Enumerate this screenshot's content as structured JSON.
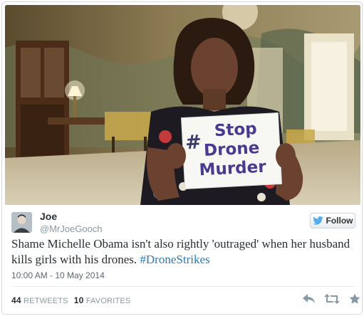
{
  "photo": {
    "sign_lines": [
      "#Stop",
      "Drone",
      "Murder"
    ]
  },
  "tweet": {
    "display_name": "Joe",
    "screen_name": "@MrJoeGooch",
    "follow_label": "Follow",
    "text_before": "Shame Michelle Obama isn't also rightly 'outraged' when her husband kills girls with his drones. ",
    "hashtag": "#DroneStrikes",
    "timestamp": "10:00 AM - 10 May 2014",
    "retweets_count": "44",
    "retweets_label": "RETWEETS",
    "favorites_count": "10",
    "favorites_label": "FAVORITES"
  },
  "colors": {
    "link": "#2b7bb9",
    "muted": "#8899a6",
    "twitter_blue": "#55acee",
    "action_icon": "#8899a6"
  },
  "icons": {
    "follow": "twitter-bird-icon",
    "actions": [
      "reply-icon",
      "retweet-icon",
      "favorite-star-icon"
    ]
  }
}
